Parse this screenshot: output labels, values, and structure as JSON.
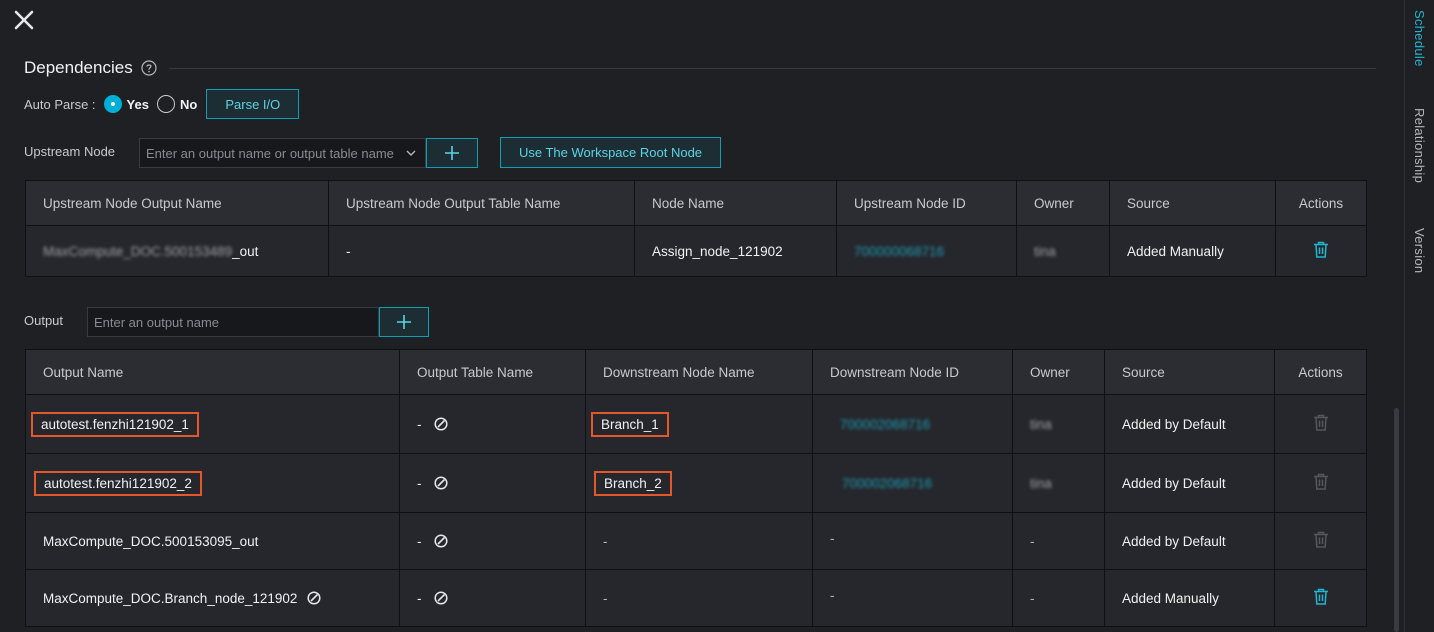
{
  "panel": {
    "section_title": "Dependencies",
    "auto_parse": {
      "label": "Auto Parse :",
      "yes_label": "Yes",
      "no_label": "No",
      "selected": "Yes",
      "parse_button": "Parse I/O"
    }
  },
  "upstream": {
    "label": "Upstream Node",
    "search_placeholder": "Enter an output name or output table name",
    "root_button": "Use The Workspace Root Node",
    "columns": [
      "Upstream Node Output Name",
      "Upstream Node Output Table Name",
      "Node Name",
      "Upstream Node ID",
      "Owner",
      "Source",
      "Actions"
    ],
    "rows": [
      {
        "output_name_prefix": "MaxCompute_DOC.500153489",
        "output_name_suffix": "_out",
        "output_table": "-",
        "node_name": "Assign_node_121902",
        "node_id": "700000068716",
        "owner": "tina",
        "source": "Added Manually"
      }
    ]
  },
  "output": {
    "label": "Output",
    "input_placeholder": "Enter an output name",
    "columns": [
      "Output Name",
      "Output Table Name",
      "Downstream Node Name",
      "Downstream Node ID",
      "Owner",
      "Source",
      "Actions"
    ],
    "rows": [
      {
        "output_name": "autotest.fenzhi121902_1",
        "output_table": "-",
        "downstream_node_name": "Branch_1",
        "downstream_node_id": "700002068716",
        "owner": "tina",
        "source": "Added by Default"
      },
      {
        "output_name": "autotest.fenzhi121902_2",
        "output_table": "-",
        "downstream_node_name": "Branch_2",
        "downstream_node_id": "700002068716",
        "owner": "tina",
        "source": "Added by Default"
      },
      {
        "output_name": "MaxCompute_DOC.500153095_out",
        "output_table": "-",
        "downstream_node_name": "-",
        "downstream_node_id": "-",
        "owner": "-",
        "source": "Added by Default"
      },
      {
        "output_name": "MaxCompute_DOC.Branch_node_121902",
        "output_table": "-",
        "downstream_node_name": "-",
        "downstream_node_id": "-",
        "owner": "-",
        "source": "Added Manually"
      }
    ]
  },
  "sidebar": {
    "tabs": [
      "Schedule",
      "Relationship",
      "Version"
    ],
    "active": "Schedule"
  },
  "colors": {
    "accent": "#1fb6d0",
    "highlight_box": "#e2572b",
    "background": "#1f2024"
  },
  "icons": [
    "close-icon",
    "help-icon",
    "chevron-down-icon",
    "plus-icon",
    "edit-icon",
    "trash-icon"
  ]
}
